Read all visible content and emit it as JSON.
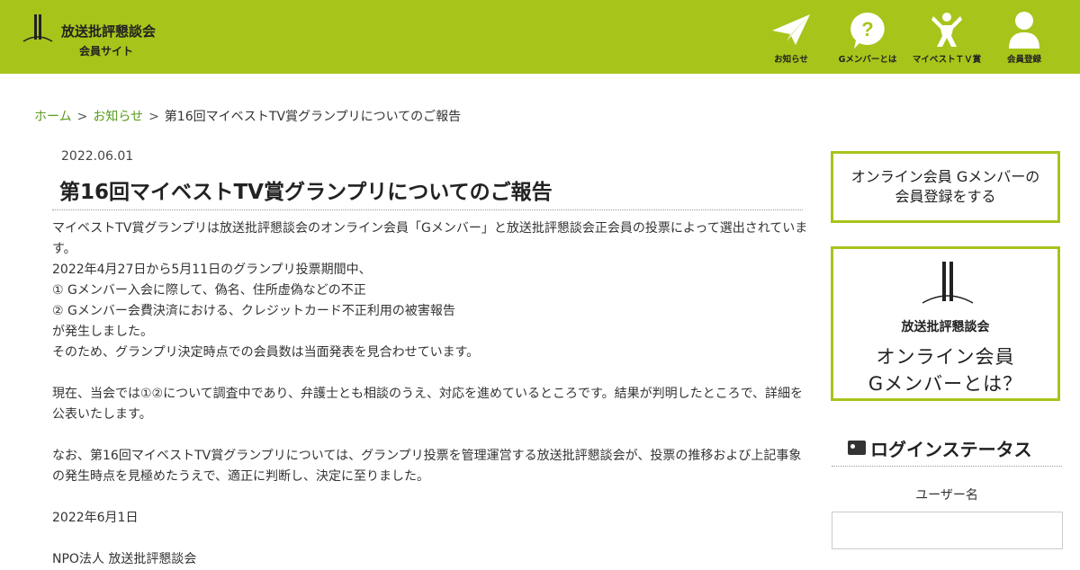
{
  "site": {
    "title": "放送批評懇談会",
    "subtitle": "会員サイト"
  },
  "nav": [
    {
      "label": "お知らせ",
      "icon": "paper-plane-icon"
    },
    {
      "label": "Gメンバーとは",
      "icon": "question-bubble-icon"
    },
    {
      "label": "マイベストＴＶ賞",
      "icon": "trophy-figure-icon"
    },
    {
      "label": "会員登録",
      "icon": "user-icon"
    }
  ],
  "breadcrumb": {
    "home": "ホーム",
    "news": "お知らせ",
    "current": "第16回マイベストTV賞グランプリについてのご報告",
    "separator": ">"
  },
  "article": {
    "date": "2022.06.01",
    "title": "第16回マイベストTV賞グランプリについてのご報告",
    "paragraphs": [
      "マイベストTV賞グランプリは放送批評懇談会のオンライン会員「Gメンバー」と放送批評懇談会正会員の投票によって選出されています。",
      "2022年4月27日から5月11日のグランプリ投票期間中、",
      "① Gメンバー入会に際して、偽名、住所虚偽などの不正",
      "② Gメンバー会費決済における、クレジットカード不正利用の被害報告",
      "が発生しました。",
      "そのため、グランプリ決定時点での会員数は当面発表を見合わせています。",
      "現在、当会では①②について調査中であり、弁護士とも相談のうえ、対応を進めているところです。結果が判明したところで、詳細を公表いたします。",
      "なお、第16回マイベストTV賞グランプリについては、グランプリ投票を管理運営する放送批評懇談会が、投票の推移および上記事象の発生時点を見極めたうえで、適正に判断し、決定に至りました。",
      "2022年6月1日",
      "NPO法人 放送批評懇談会"
    ]
  },
  "sidebar": {
    "register_line1": "オンライン会員 Gメンバーの",
    "register_line2": "会員登録をする",
    "about_org": "放送批評懇談会",
    "about_line1": "オンライン会員",
    "about_line2": "Gメンバーとは？",
    "login_heading": "ログインステータス",
    "username_label": "ユーザー名",
    "username_value": ""
  },
  "colors": {
    "header": "#a7c41a",
    "link": "#5a9c1f",
    "border": "#a7c41a"
  }
}
